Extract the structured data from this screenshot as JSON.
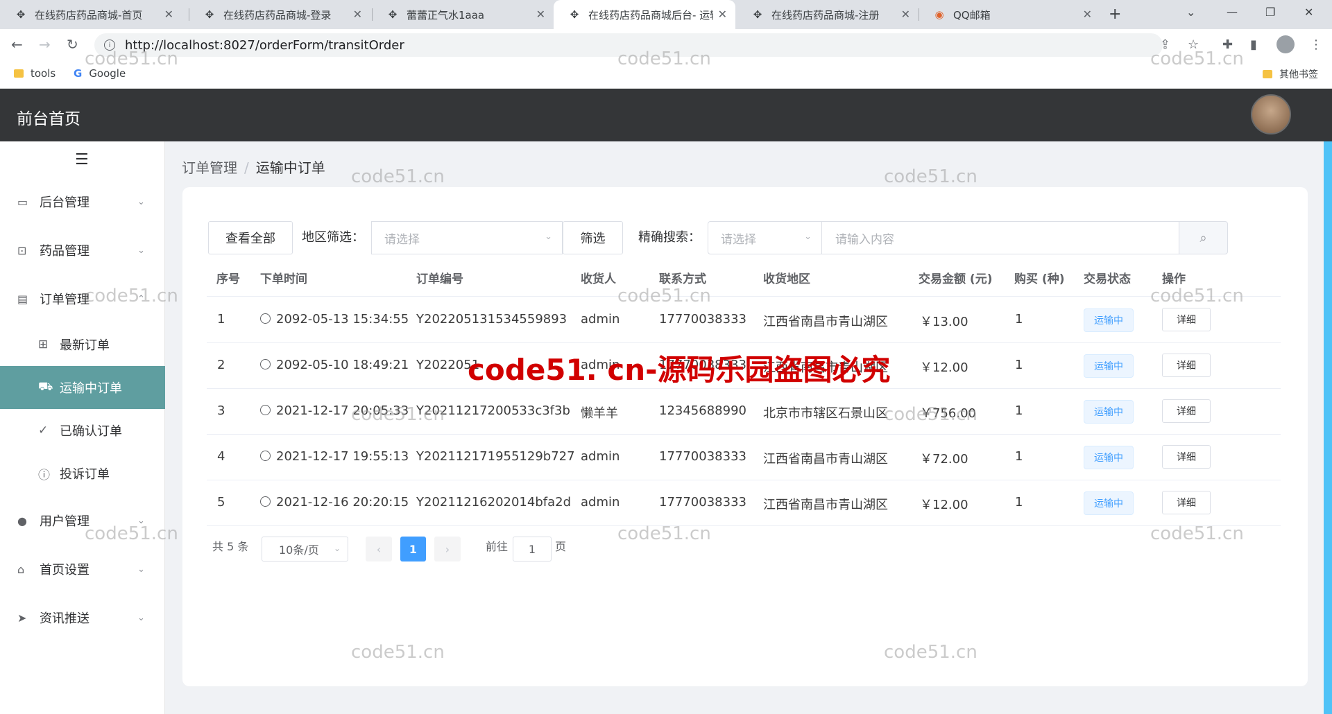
{
  "browser": {
    "tabs": [
      {
        "title": "在线药店药品商城-首页"
      },
      {
        "title": "在线药店药品商城-登录"
      },
      {
        "title": "蕾蕾正气水1aaa"
      },
      {
        "title": "在线药店药品商城后台- 运输"
      },
      {
        "title": "在线药店药品商城-注册"
      },
      {
        "title": "QQ邮箱"
      }
    ],
    "url": "http://localhost:8027/orderForm/transitOrder",
    "bookmarks": {
      "tools": "tools",
      "google": "Google",
      "other": "其他书签"
    }
  },
  "header": {
    "brand": "前台首页"
  },
  "sidebar": {
    "menus": [
      {
        "label": "后台管理"
      },
      {
        "label": "药品管理"
      },
      {
        "label": "订单管理"
      },
      {
        "label": "用户管理"
      },
      {
        "label": "首页设置"
      },
      {
        "label": "资讯推送"
      }
    ],
    "sub_items": [
      {
        "label": "最新订单"
      },
      {
        "label": "运输中订单"
      },
      {
        "label": "已确认订单"
      },
      {
        "label": "投诉订单"
      }
    ]
  },
  "breadcrumb": {
    "parent": "订单管理",
    "separator": "/",
    "current": "运输中订单"
  },
  "toolbar": {
    "view_all": "查看全部",
    "region_label": "地区筛选：",
    "region_placeholder": "请选择",
    "filter": "筛选",
    "exact_label": "精确搜索：",
    "exact_placeholder": "请选择",
    "search_placeholder": "请输入内容"
  },
  "table": {
    "headers": [
      "序号",
      "下单时间",
      "订单编号",
      "收货人",
      "联系方式",
      "收货地区",
      "交易金额 (元)",
      "购买 (种)",
      "交易状态",
      "操作"
    ],
    "rows": [
      {
        "index": "1",
        "time": "2092-05-13 15:34:55",
        "order_no": "Y202205131534559893",
        "receiver": "admin",
        "phone": "17770038333",
        "region": "江西省南昌市青山湖区",
        "amount": "￥13.00",
        "count": "1",
        "status": "运输中",
        "action": "详细"
      },
      {
        "index": "2",
        "time": "2092-05-10 18:49:21",
        "order_no": "Y2022051",
        "receiver": "admin",
        "phone": "17770038333",
        "region": "江西省南昌市青山湖区",
        "amount": "￥12.00",
        "count": "1",
        "status": "运输中",
        "action": "详细"
      },
      {
        "index": "3",
        "time": "2021-12-17 20:05:33",
        "order_no": "Y20211217200533c3f3b",
        "receiver": "懒羊羊",
        "phone": "12345688990",
        "region": "北京市市辖区石景山区",
        "amount": "￥756.00",
        "count": "1",
        "status": "运输中",
        "action": "详细"
      },
      {
        "index": "4",
        "time": "2021-12-17 19:55:13",
        "order_no": "Y202112171955129b727",
        "receiver": "admin",
        "phone": "17770038333",
        "region": "江西省南昌市青山湖区",
        "amount": "￥72.00",
        "count": "1",
        "status": "运输中",
        "action": "详细"
      },
      {
        "index": "5",
        "time": "2021-12-16 20:20:15",
        "order_no": "Y20211216202014bfa2d",
        "receiver": "admin",
        "phone": "17770038333",
        "region": "江西省南昌市青山湖区",
        "amount": "￥12.00",
        "count": "1",
        "status": "运输中",
        "action": "详细"
      }
    ]
  },
  "pagination": {
    "total": "共 5 条",
    "page_size": "10条/页",
    "current_page": "1",
    "goto_label": "前往",
    "goto_value": "1",
    "page_suffix": "页"
  },
  "watermark": {
    "small": "code51.cn",
    "big": "code51. cn-源码乐园盗图必究"
  },
  "colors": {
    "header_bg": "#343638",
    "active_menu": "#5f9ea0",
    "primary": "#409eff"
  }
}
